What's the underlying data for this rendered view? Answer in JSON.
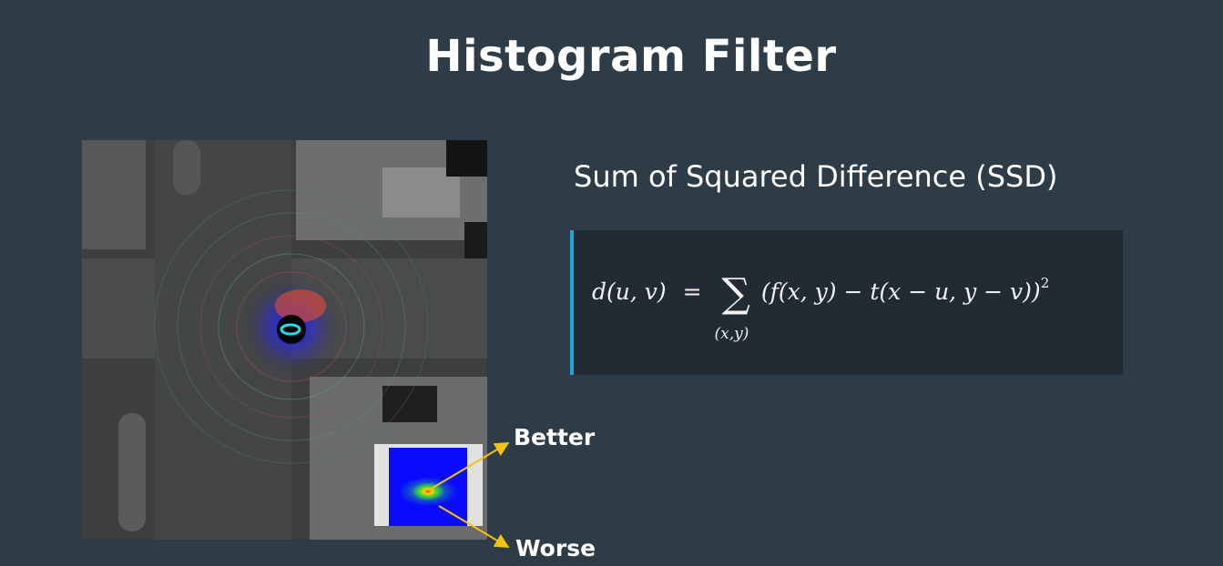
{
  "slide": {
    "title": "Histogram Filter",
    "subtitle": "Sum of Squared Difference (SSD)"
  },
  "formula": {
    "lhs": "d(u, v)",
    "equals": "=",
    "sigma": "∑",
    "sum_index": "(x,y)",
    "body": "(f(x, y) − t(x − u, y − v))",
    "exponent": "2"
  },
  "annotations": {
    "better": "Better",
    "worse": "Worse"
  },
  "colors": {
    "background": "#2e3c48",
    "accent_bar": "#1aa7d7",
    "arrow": "#f3c20f"
  }
}
